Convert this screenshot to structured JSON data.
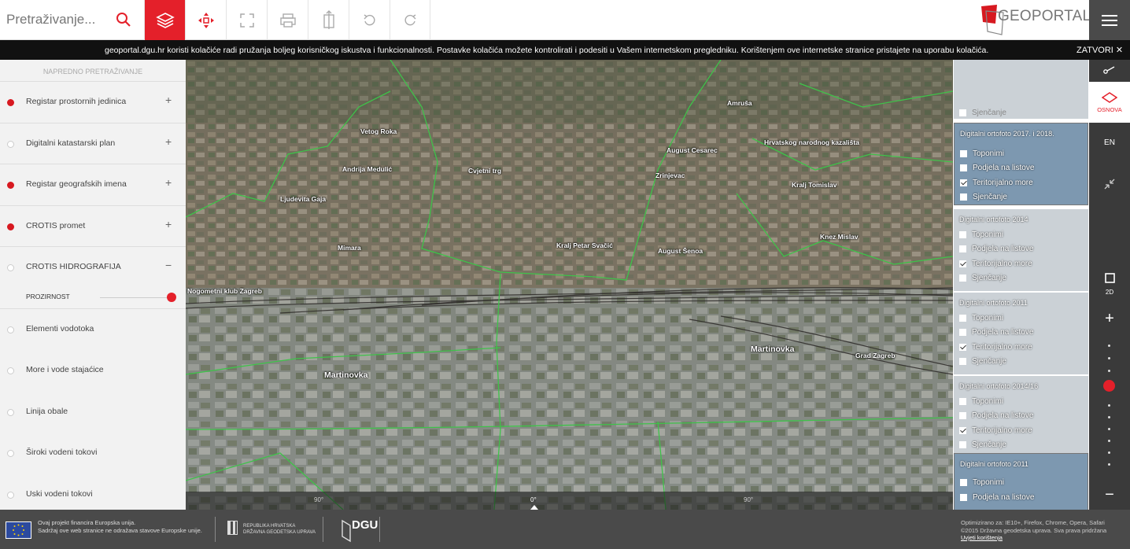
{
  "search": {
    "placeholder": "Pretraživanje..."
  },
  "toolbar": {
    "buttons": [
      {
        "name": "layers-button",
        "icon": "layers-icon"
      },
      {
        "name": "move-button",
        "icon": "move-arrows-icon"
      },
      {
        "name": "fullscreen-button",
        "icon": "fullscreen-icon"
      },
      {
        "name": "print-button",
        "icon": "print-icon"
      },
      {
        "name": "export-button",
        "icon": "export-icon"
      },
      {
        "name": "undo-button",
        "icon": "undo-icon"
      },
      {
        "name": "redo-button",
        "icon": "redo-icon"
      }
    ],
    "accent": "#e4202a"
  },
  "logo": {
    "text": "GEOPORTAL"
  },
  "cookie": {
    "text": "geoportal.dgu.hr koristi kolačiće radi pružanja boljeg korisničkog iskustva i funkcionalnosti. Postavke kolačića možete kontrolirati i podesiti u Vašem internetskom pregledniku. Korištenjem ove internetske stranice pristajete na uporabu kolačića.",
    "close_label": "ZATVORI"
  },
  "sidebar": {
    "advanced_search": "NAPREDNO PRETRAŽIVANJE",
    "layers": [
      {
        "label": "Registar prostornih jedinica",
        "active": true,
        "toggle": "+"
      },
      {
        "label": "Digitalni katastarski plan",
        "active": false,
        "toggle": "+"
      },
      {
        "label": "Registar geografskih imena",
        "active": true,
        "toggle": "+"
      },
      {
        "label": "CROTIS promet",
        "active": true,
        "toggle": "+"
      },
      {
        "label": "CROTIS HIDROGRAFIJA",
        "active": false,
        "toggle": "−"
      }
    ],
    "opacity_label": "PROZIRNOST",
    "sublayers": [
      {
        "label": "Elementi vodotoka"
      },
      {
        "label": "More i vode stajaćice"
      },
      {
        "label": "Linija obale"
      },
      {
        "label": "Široki vodeni tokovi"
      },
      {
        "label": "Uski vodeni tokovi"
      }
    ]
  },
  "map": {
    "labels": [
      {
        "text": "Vetog Roka"
      },
      {
        "text": "Amruša"
      },
      {
        "text": "August Cesarec"
      },
      {
        "text": "Hrvatskog narodnog kazališta"
      },
      {
        "text": "Andrija Medulić"
      },
      {
        "text": "Cvjetni trg"
      },
      {
        "text": "Zrinjevac"
      },
      {
        "text": "Kralj Tomislav"
      },
      {
        "text": "Ljudevita Gaja"
      },
      {
        "text": "Mimara"
      },
      {
        "text": "Kralj Petar Svačić"
      },
      {
        "text": "August Šenoa"
      },
      {
        "text": "Knez Mislav"
      },
      {
        "text": "Martinovka"
      },
      {
        "text": "Martinovka"
      },
      {
        "text": "Grad Zagreb"
      },
      {
        "text": "Nogometni klub Zagreb"
      }
    ],
    "compass": [
      "90°",
      "0°",
      "90°"
    ]
  },
  "basemaps": {
    "top_option": "Sjenčanje",
    "cards": [
      {
        "title": "Digitalni ortofoto 2017. i 2018.",
        "selected": true,
        "options": [
          {
            "label": "Toponimi",
            "checked": false
          },
          {
            "label": "Podjela na listove",
            "checked": false
          },
          {
            "label": "Teritorijalno more",
            "checked": true
          },
          {
            "label": "Sjenčanje",
            "checked": false
          }
        ]
      },
      {
        "title": "Digitalni ortofoto 2014",
        "selected": false,
        "options": [
          {
            "label": "Toponimi",
            "checked": false
          },
          {
            "label": "Podjela na listove",
            "checked": false
          },
          {
            "label": "Teritorijalno more",
            "checked": true
          },
          {
            "label": "Sjenčanje",
            "checked": false
          }
        ]
      },
      {
        "title": "Digitalni ortofoto 2011",
        "selected": false,
        "options": [
          {
            "label": "Toponimi",
            "checked": false
          },
          {
            "label": "Podjela na listove",
            "checked": false
          },
          {
            "label": "Teritorijalno more",
            "checked": true
          },
          {
            "label": "Sjenčanje",
            "checked": false
          }
        ]
      },
      {
        "title": "Digitalni ortofoto 2014/16",
        "selected": false,
        "options": [
          {
            "label": "Toponimi",
            "checked": false
          },
          {
            "label": "Podjela na listove",
            "checked": false
          },
          {
            "label": "Teritorijalno more",
            "checked": true
          },
          {
            "label": "Sjenčanje",
            "checked": false
          }
        ]
      },
      {
        "title": "Digitalni ortofoto 2011",
        "selected": false,
        "options": [
          {
            "label": "Toponimi",
            "checked": false
          },
          {
            "label": "Podjela na listove",
            "checked": false
          }
        ]
      }
    ]
  },
  "right_tools": {
    "osnova_label": "OSNOVA",
    "lang_label": "EN",
    "mode_label": "2D",
    "zoom_in": "+",
    "zoom_out": "−"
  },
  "footer": {
    "eu_line1": "Ovaj projekt financira Europska unija.",
    "eu_line2": "Sadržaj ove web stranice ne odražava stavove Europske unije.",
    "cro_line1": "REPUBLIKA HRVATSKA",
    "cro_line2": "DRŽAVNA GEODETSKA UPRAVA",
    "dgu": "DGU",
    "opt_line1": "Optimizirano za: IE10+, Firefox, Chrome, Opera, Safari",
    "opt_line2": "©2015 Državna geodetska uprava. Sva prava pridržana",
    "terms": "Uvjeti korištenja"
  }
}
